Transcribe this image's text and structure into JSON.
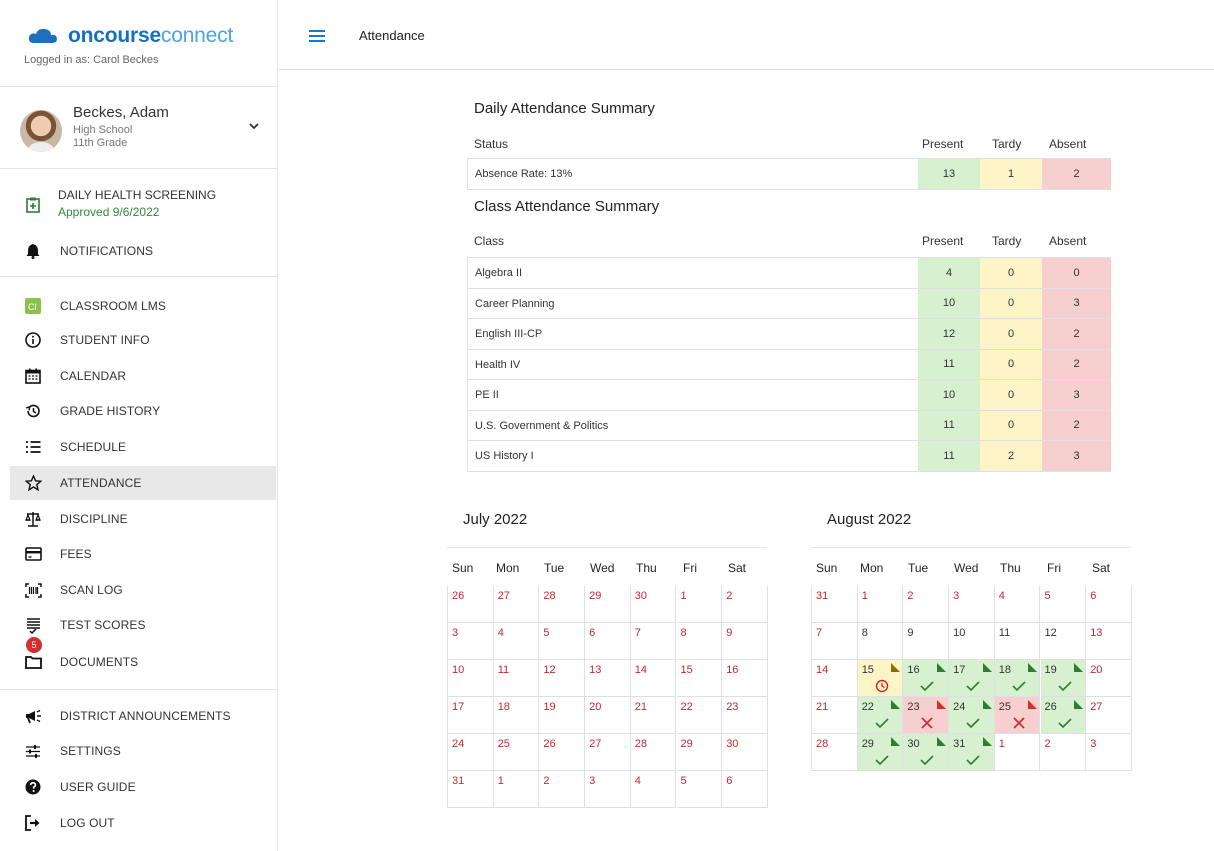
{
  "app": {
    "logo_bold": "oncourse",
    "logo_light": "connect",
    "logged_in": "Logged in as: Carol Beckes"
  },
  "student": {
    "name": "Beckes, Adam",
    "school": "High School",
    "grade": "11th Grade"
  },
  "health": {
    "label": "DAILY HEALTH SCREENING",
    "status": "Approved 9/6/2022"
  },
  "nav": {
    "notifications": "NOTIFICATIONS",
    "classroom": "CLASSROOM LMS",
    "student_info": "STUDENT INFO",
    "calendar": "CALENDAR",
    "grade_history": "GRADE HISTORY",
    "schedule": "SCHEDULE",
    "attendance": "ATTENDANCE",
    "discipline": "DISCIPLINE",
    "fees": "FEES",
    "scan_log": "SCAN LOG",
    "test_scores": "TEST SCORES",
    "documents": "DOCUMENTS",
    "documents_badge": "5",
    "district": "DISTRICT ANNOUNCEMENTS",
    "settings": "SETTINGS",
    "user_guide": "USER GUIDE",
    "log_out": "LOG OUT"
  },
  "topbar": {
    "title": "Attendance"
  },
  "daily": {
    "title": "Daily Attendance Summary",
    "col_status": "Status",
    "col_present": "Present",
    "col_tardy": "Tardy",
    "col_absent": "Absent",
    "row": {
      "label": "Absence Rate: 13%",
      "present": "13",
      "tardy": "1",
      "absent": "2"
    }
  },
  "classes": {
    "title": "Class Attendance Summary",
    "col_class": "Class",
    "col_present": "Present",
    "col_tardy": "Tardy",
    "col_absent": "Absent",
    "rows": [
      {
        "name": "Algebra II",
        "present": "4",
        "tardy": "0",
        "absent": "0"
      },
      {
        "name": "Career Planning",
        "present": "10",
        "tardy": "0",
        "absent": "3"
      },
      {
        "name": "English III-CP",
        "present": "12",
        "tardy": "0",
        "absent": "2"
      },
      {
        "name": "Health IV",
        "present": "11",
        "tardy": "0",
        "absent": "2"
      },
      {
        "name": "PE II",
        "present": "10",
        "tardy": "0",
        "absent": "3"
      },
      {
        "name": "U.S. Government & Politics",
        "present": "11",
        "tardy": "0",
        "absent": "2"
      },
      {
        "name": "US History I",
        "present": "11",
        "tardy": "2",
        "absent": "3"
      }
    ]
  },
  "calendars": {
    "dow": [
      "Sun",
      "Mon",
      "Tue",
      "Wed",
      "Thu",
      "Fri",
      "Sat"
    ],
    "july": {
      "title": "July 2022",
      "days": [
        "26",
        "27",
        "28",
        "29",
        "30",
        "1",
        "2",
        "3",
        "4",
        "5",
        "6",
        "7",
        "8",
        "9",
        "10",
        "11",
        "12",
        "13",
        "14",
        "15",
        "16",
        "17",
        "18",
        "19",
        "20",
        "21",
        "22",
        "23",
        "24",
        "25",
        "26",
        "27",
        "28",
        "29",
        "30",
        "31",
        "1",
        "2",
        "3",
        "4",
        "5",
        "6"
      ]
    },
    "august": {
      "title": "August 2022",
      "days": [
        "31",
        "1",
        "2",
        "3",
        "4",
        "5",
        "6",
        "7",
        "8",
        "9",
        "10",
        "11",
        "12",
        "13",
        "14",
        "15",
        "16",
        "17",
        "18",
        "19",
        "20",
        "21",
        "22",
        "23",
        "24",
        "25",
        "26",
        "27",
        "28",
        "29",
        "30",
        "31",
        "1",
        "2",
        "3"
      ],
      "status": [
        "",
        "",
        "",
        "",
        "",
        "",
        "",
        "",
        "dark",
        "dark",
        "dark",
        "dark",
        "dark",
        "",
        "",
        "tardy",
        "present",
        "present",
        "present",
        "present",
        "",
        "",
        "present",
        "absent",
        "present",
        "absent",
        "present",
        "",
        "",
        "present",
        "present",
        "present",
        "",
        "",
        ""
      ],
      "colors": {
        "present": "#d7f1d0",
        "tardy": "#fdf5c8",
        "absent": "#f8cfcf",
        "check": "#2e7d32",
        "cross": "#d32f2f",
        "tardy_icon": "#c62828"
      }
    }
  }
}
